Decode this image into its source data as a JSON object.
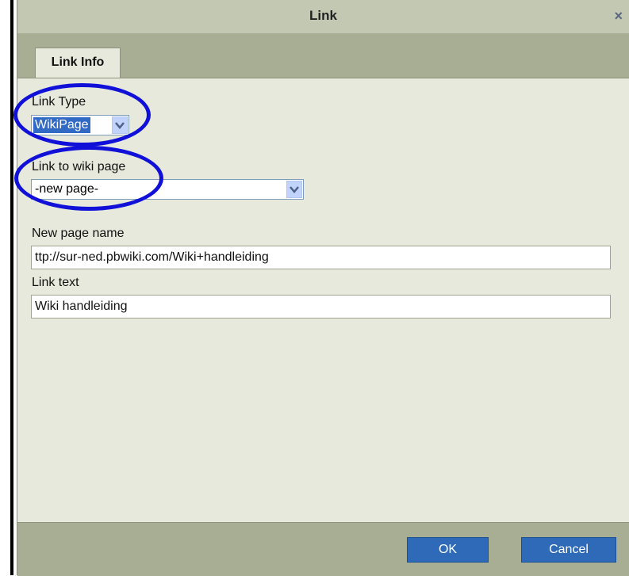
{
  "dialog": {
    "title": "Link",
    "close_glyph": "×",
    "tabs": [
      {
        "label": "Link Info"
      }
    ]
  },
  "form": {
    "link_type": {
      "label": "Link Type",
      "value": "WikiPage"
    },
    "wiki_page": {
      "label": "Link to wiki page",
      "value": "-new page-"
    },
    "new_page_name": {
      "label": "New page name",
      "value": "ttp://sur-ned.pbwiki.com/Wiki+handleiding"
    },
    "link_text": {
      "label": "Link text",
      "value": "Wiki handleiding"
    }
  },
  "buttons": {
    "ok": "OK",
    "cancel": "Cancel"
  },
  "icons": {
    "close": "close-icon",
    "dropdown": "chevron-down-icon"
  },
  "colors": {
    "annotation": "#1010d8",
    "button": "#2e6ab8",
    "selection": "#316ac5"
  }
}
